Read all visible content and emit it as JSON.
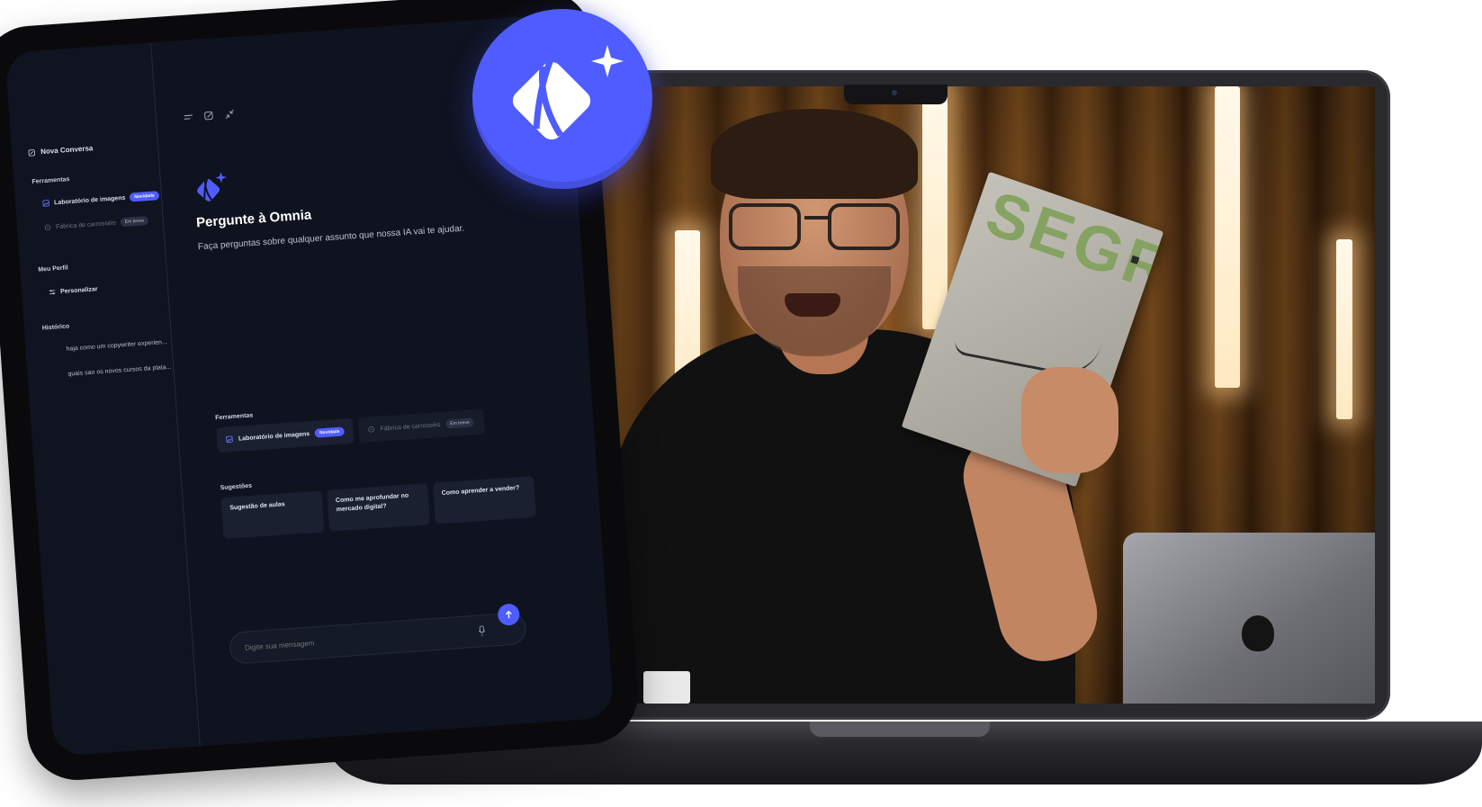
{
  "brand": {
    "accent": "#4f5cff",
    "logo_icon": "omnia-logo-icon"
  },
  "sidebar": {
    "new_chat_label": "Nova Conversa",
    "tools_heading": "Ferramentas",
    "tools": [
      {
        "label": "Laboratório de imagens",
        "badge": "Novidade",
        "icon": "image-icon"
      },
      {
        "label": "Fábrica de carrosséis",
        "badge": "Em breve",
        "icon": "carousel-icon"
      }
    ],
    "profile_heading": "Meu Perfil",
    "personalize_label": "Personalizar",
    "history_heading": "Histórico",
    "history": [
      "haja como um copywriter experien...",
      "quais sao os novos cursos da plata..."
    ]
  },
  "main": {
    "title": "Pergunte à Omnia",
    "subtitle": "Faça perguntas sobre qualquer assunto que nossa IA vai te ajudar.",
    "tools_heading": "Ferramentas",
    "tools": [
      {
        "label": "Laboratório de imagens",
        "badge": "Novidade"
      },
      {
        "label": "Fábrica de carrosséis",
        "badge": "Em breve"
      }
    ],
    "suggestions_heading": "Sugestões",
    "suggestions": [
      "Sugestão de aulas",
      "Como me aprofundar no mercado digital?",
      "Como aprender a vender?"
    ],
    "composer_placeholder": "Digite sua mensagem"
  },
  "video": {
    "book_text": "SEGREDO"
  }
}
